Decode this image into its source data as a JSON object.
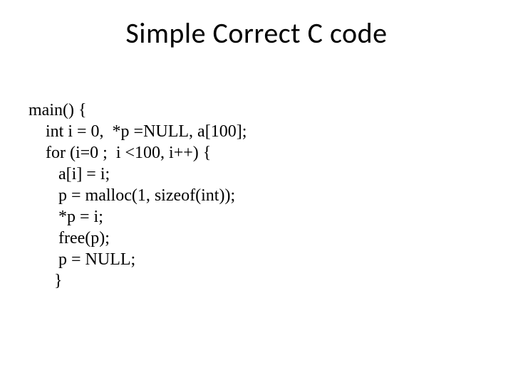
{
  "title": "Simple Correct C code",
  "code": {
    "l1": "main() {",
    "l2": "    int i = 0,  *p =NULL, a[100];",
    "l3": "    for (i=0 ;  i <100, i++) {",
    "l4": "       a[i] = i;",
    "l5": "       p = malloc(1, sizeof(int));",
    "l6": "       *p = i;",
    "l7": "       free(p);",
    "l8": "       p = NULL;",
    "l9": "      }"
  }
}
